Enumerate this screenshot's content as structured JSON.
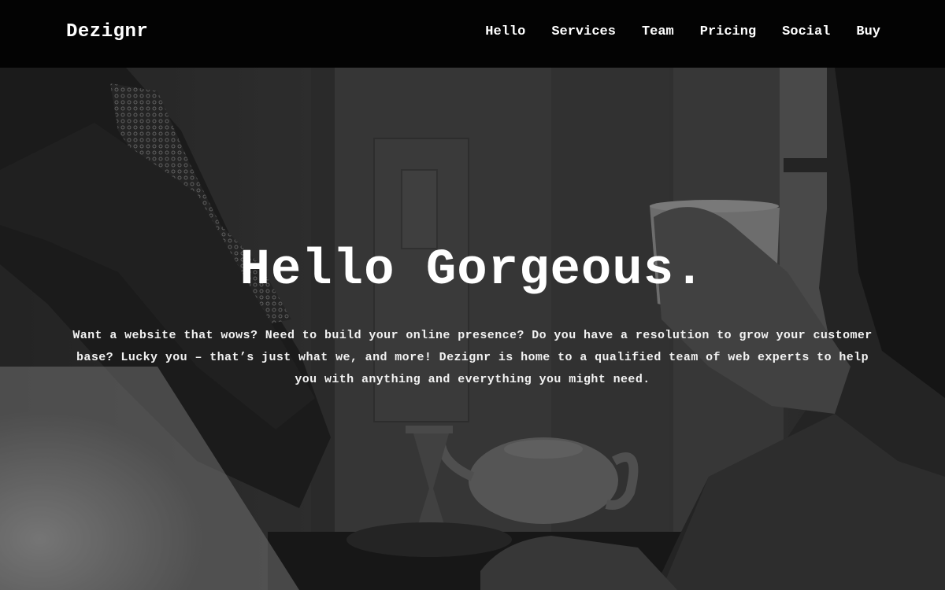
{
  "navbar": {
    "brand": "Dezignr",
    "links": [
      {
        "label": "Hello"
      },
      {
        "label": "Services"
      },
      {
        "label": "Team"
      },
      {
        "label": "Pricing"
      },
      {
        "label": "Social"
      },
      {
        "label": "Buy"
      }
    ]
  },
  "hero": {
    "title": "Hello Gorgeous.",
    "text": "Want a website that wows? Need to build your online presence? Do you have a resolution to grow your customer base? Lucky you – that’s just what we, and more! Dezignr is home to a qualified team of web experts to help you with anything and everything you might need.",
    "image_style": "black-and-white photo"
  },
  "colors": {
    "navbar_bg": "#030303",
    "text": "#ffffff"
  }
}
